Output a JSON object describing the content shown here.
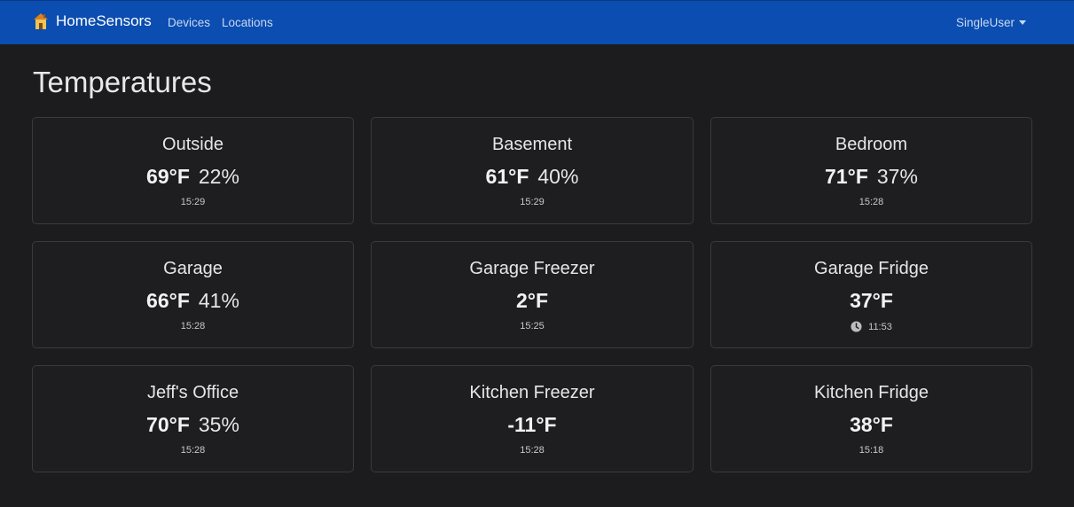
{
  "navbar": {
    "brand": "HomeSensors",
    "links": [
      "Devices",
      "Locations"
    ],
    "user": "SingleUser",
    "icons": {
      "brand": "house-icon",
      "user_menu": "caret-down-icon"
    },
    "color": "#0b4db0"
  },
  "page": {
    "title": "Temperatures"
  },
  "sensors": [
    {
      "name": "Outside",
      "temp": "69°F",
      "humidity": "22%",
      "time": "15:29",
      "stale": false
    },
    {
      "name": "Basement",
      "temp": "61°F",
      "humidity": "40%",
      "time": "15:29",
      "stale": false
    },
    {
      "name": "Bedroom",
      "temp": "71°F",
      "humidity": "37%",
      "time": "15:28",
      "stale": false
    },
    {
      "name": "Garage",
      "temp": "66°F",
      "humidity": "41%",
      "time": "15:28",
      "stale": false
    },
    {
      "name": "Garage Freezer",
      "temp": "2°F",
      "humidity": "",
      "time": "15:25",
      "stale": false
    },
    {
      "name": "Garage Fridge",
      "temp": "37°F",
      "humidity": "",
      "time": "11:53",
      "stale": true,
      "stale_icon": "clock-icon"
    },
    {
      "name": "Jeff's Office",
      "temp": "70°F",
      "humidity": "35%",
      "time": "15:28",
      "stale": false
    },
    {
      "name": "Kitchen Freezer",
      "temp": "-11°F",
      "humidity": "",
      "time": "15:28",
      "stale": false
    },
    {
      "name": "Kitchen Fridge",
      "temp": "38°F",
      "humidity": "",
      "time": "15:18",
      "stale": false
    }
  ]
}
